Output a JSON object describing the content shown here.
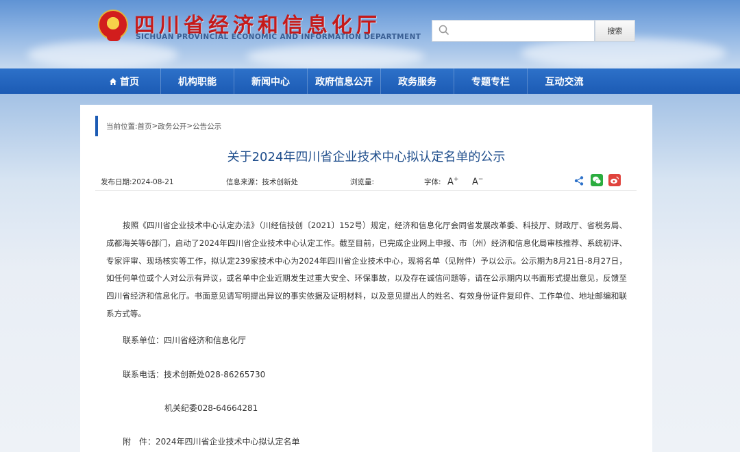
{
  "header": {
    "title": "四川省经济和信息化厅",
    "subtitle": "SICHUAN PROVINCIAL ECONOMIC AND INFORMATION DEPARTMENT",
    "search": {
      "placeholder": "",
      "button_label": "搜索"
    }
  },
  "nav": {
    "items": [
      "首页",
      "机构职能",
      "新闻中心",
      "政府信息公开",
      "政务服务",
      "专题专栏",
      "互动交流"
    ]
  },
  "breadcrumb": {
    "prefix": "当前位置:",
    "items": [
      "首页",
      "政务公开",
      "公告公示"
    ],
    "separator": ">"
  },
  "article": {
    "title": "关于2024年四川省企业技术中心拟认定名单的公示",
    "meta": {
      "date": "发布日期:2024-08-21",
      "source": "信息来源：技术创新处",
      "views": "浏览量:",
      "font_label": "字体:",
      "font_increase": "A",
      "font_decrease": "A"
    },
    "body": "按照《四川省企业技术中心认定办法》（川经信技创〔2021〕152号）规定，经济和信息化厅会同省发展改革委、科技厅、财政厅、省税务局、成都海关等6部门，启动了2024年四川省企业技术中心认定工作。截至目前，已完成企业网上申报、市（州）经济和信息化局审核推荐、系统初评、专家评审、现场核实等工作，拟认定239家技术中心为2024年四川省企业技术中心，现将名单（见附件）予以公示。公示期为8月21日-8月27日，如任何单位或个人对公示有异议，或名单中企业近期发生过重大安全、环保事故，以及存在诚信问题等，请在公示期内以书面形式提出意见，反馈至四川省经济和信息化厅。书面意见请写明提出异议的事实依据及证明材料，以及意见提出人的姓名、有效身份证件复印件、工作单位、地址邮编和联系方式等。",
    "contact_unit": "联系单位：四川省经济和信息化厅",
    "contact_phone": "联系电话：技术创新处028-86265730",
    "contact_phone2": "机关纪委028-64664281",
    "attachment": "附　件：2024年四川省企业技术中心拟认定名单"
  },
  "colors": {
    "nav": "#1c5bb4",
    "title": "#1f4e8c",
    "brand_red": "#c51a1a",
    "wechat": "#2bad3f",
    "weibo": "#e0433d"
  }
}
